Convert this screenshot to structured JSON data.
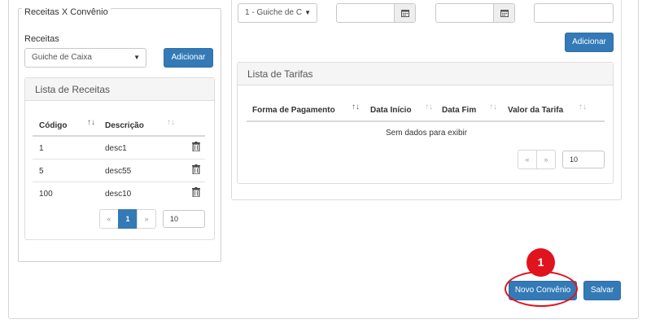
{
  "left": {
    "legend": "Receitas X Convênio",
    "receitas_label": "Receitas",
    "receitas_select": "Guiche de Caixa",
    "add_button": "Adicionar",
    "panel_title": "Lista de Receitas",
    "columns": [
      "Código",
      "Descrição"
    ],
    "rows": [
      {
        "codigo": "1",
        "descricao": "desc1"
      },
      {
        "codigo": "5",
        "descricao": "desc55"
      },
      {
        "codigo": "100",
        "descricao": "desc10"
      }
    ],
    "pagination": {
      "prev": "«",
      "page": "1",
      "next": "»",
      "page_size": "10"
    }
  },
  "right": {
    "top_select": "1 - Guiche de C",
    "date_start": "",
    "date_end": "",
    "value_input": "",
    "add_button": "Adicionar",
    "panel_title": "Lista de Tarifas",
    "columns": [
      "Forma de Pagamento",
      "Data Início",
      "Data Fim",
      "Valor da Tarifa"
    ],
    "empty_text": "Sem dados para exibir",
    "pagination": {
      "prev": "«",
      "next": "»",
      "page_size": "10"
    }
  },
  "footer": {
    "novo_convenio": "Novo Convênio",
    "salvar": "Salvar"
  },
  "annotation": {
    "step": "1",
    "color": "#e0141e"
  },
  "colors": {
    "primary": "#337ab7"
  }
}
